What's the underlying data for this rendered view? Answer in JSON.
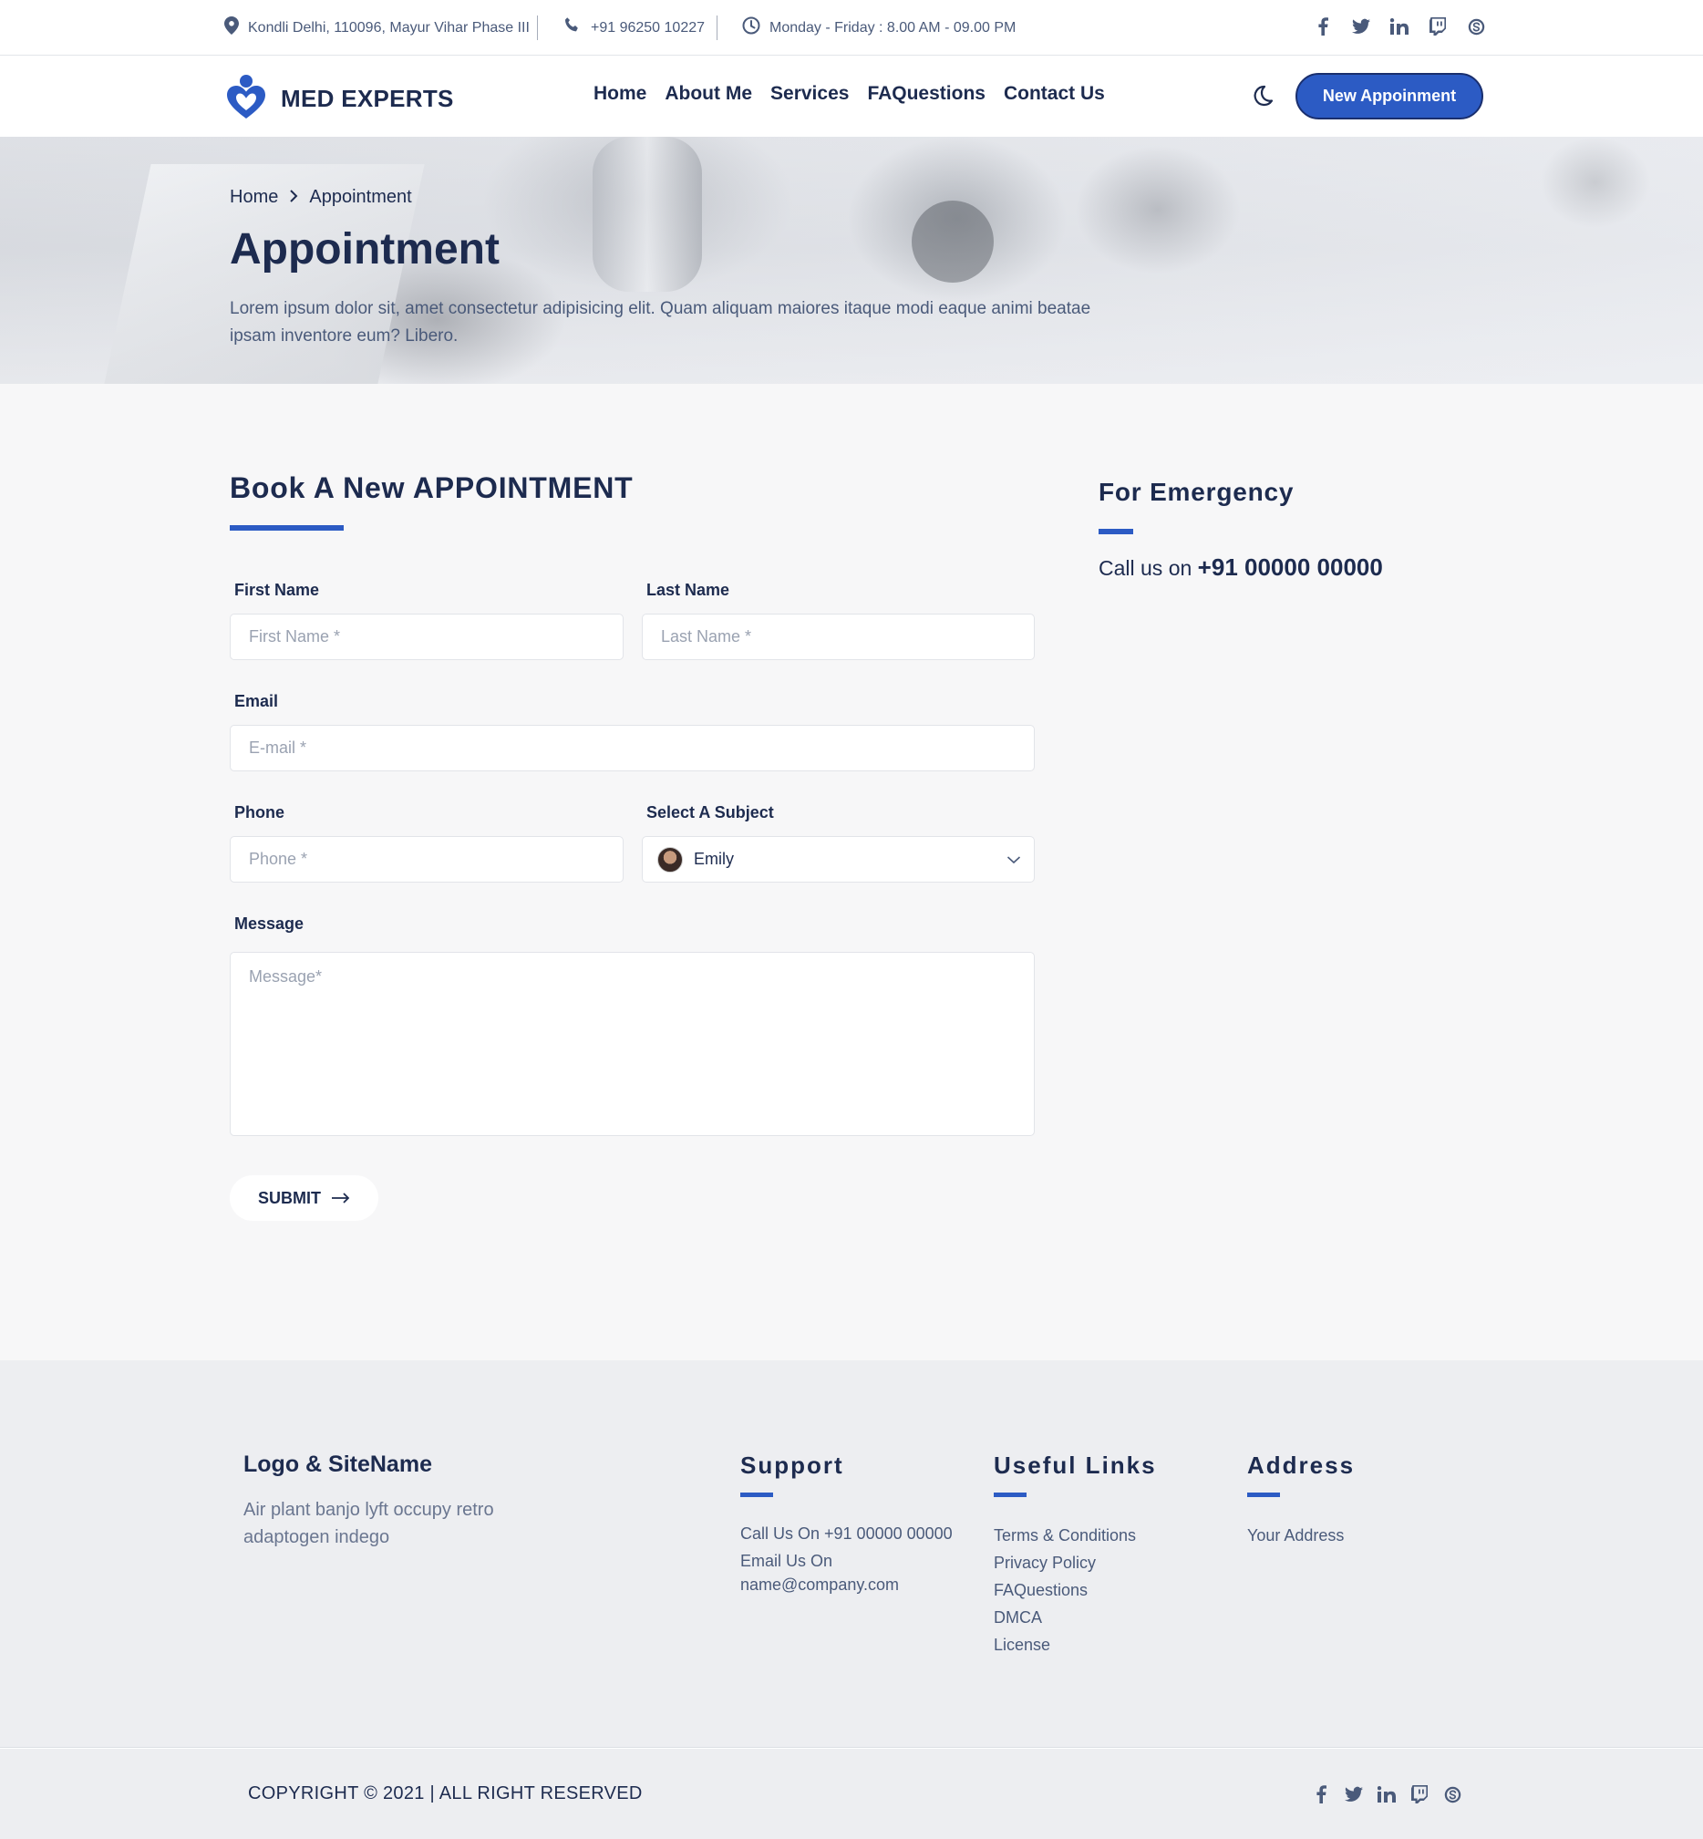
{
  "topbar": {
    "address": "Kondli Delhi, 110096, Mayur Vihar Phase III",
    "phone": "+91 96250 10227",
    "hours": "Monday - Friday : 8.00 AM - 09.00 PM",
    "social_icons": [
      "facebook-icon",
      "twitter-icon",
      "linkedin-icon",
      "twitch-icon",
      "skype-icon"
    ]
  },
  "navbar": {
    "brand": "MED EXPERTS",
    "links": [
      "Home",
      "About Me",
      "Services",
      "FAQuestions",
      "Contact Us"
    ],
    "cta": "New Appoinment"
  },
  "hero": {
    "breadcrumb": [
      "Home",
      "Appointment"
    ],
    "title": "Appointment",
    "description": "Lorem ipsum dolor sit, amet consectetur adipisicing elit. Quam aliquam maiores itaque modi eaque animi beatae ipsam inventore eum? Libero."
  },
  "form": {
    "title": "Book A New APPOINTMENT",
    "first_name_label": "First Name",
    "first_name_placeholder": "First Name *",
    "last_name_label": "Last Name",
    "last_name_placeholder": "Last Name *",
    "email_label": "Email",
    "email_placeholder": "E-mail *",
    "phone_label": "Phone",
    "phone_placeholder": "Phone *",
    "subject_label": "Select A Subject",
    "subject_value": "Emily",
    "message_label": "Message",
    "message_placeholder": "Message*",
    "submit": "SUBMIT"
  },
  "emergency": {
    "title": "For Emergency",
    "prefix": "Call us on",
    "number": "+91 00000 00000"
  },
  "footer": {
    "logo_title": "Logo & SiteName",
    "logo_desc": "Air plant banjo lyft occupy retro adaptogen indego",
    "support_title": "Support",
    "support_call": "Call Us On +91 00000 00000",
    "support_email_label": "Email Us On",
    "support_email": "name@company.com",
    "useful_title": "Useful Links",
    "useful_links": [
      "Terms & Conditions",
      "Privacy Policy",
      "FAQuestions",
      "DMCA",
      "License"
    ],
    "address_title": "Address",
    "address_value": "Your Address",
    "copyright": "COPYRIGHT © 2021  |  ALL RIGHT RESERVED"
  },
  "colors": {
    "accent": "#2c5bc4",
    "text": "#1d2b4f",
    "muted": "#4a5a7a",
    "page_bg": "#f7f7f8",
    "footer_bg": "#edeef1"
  }
}
